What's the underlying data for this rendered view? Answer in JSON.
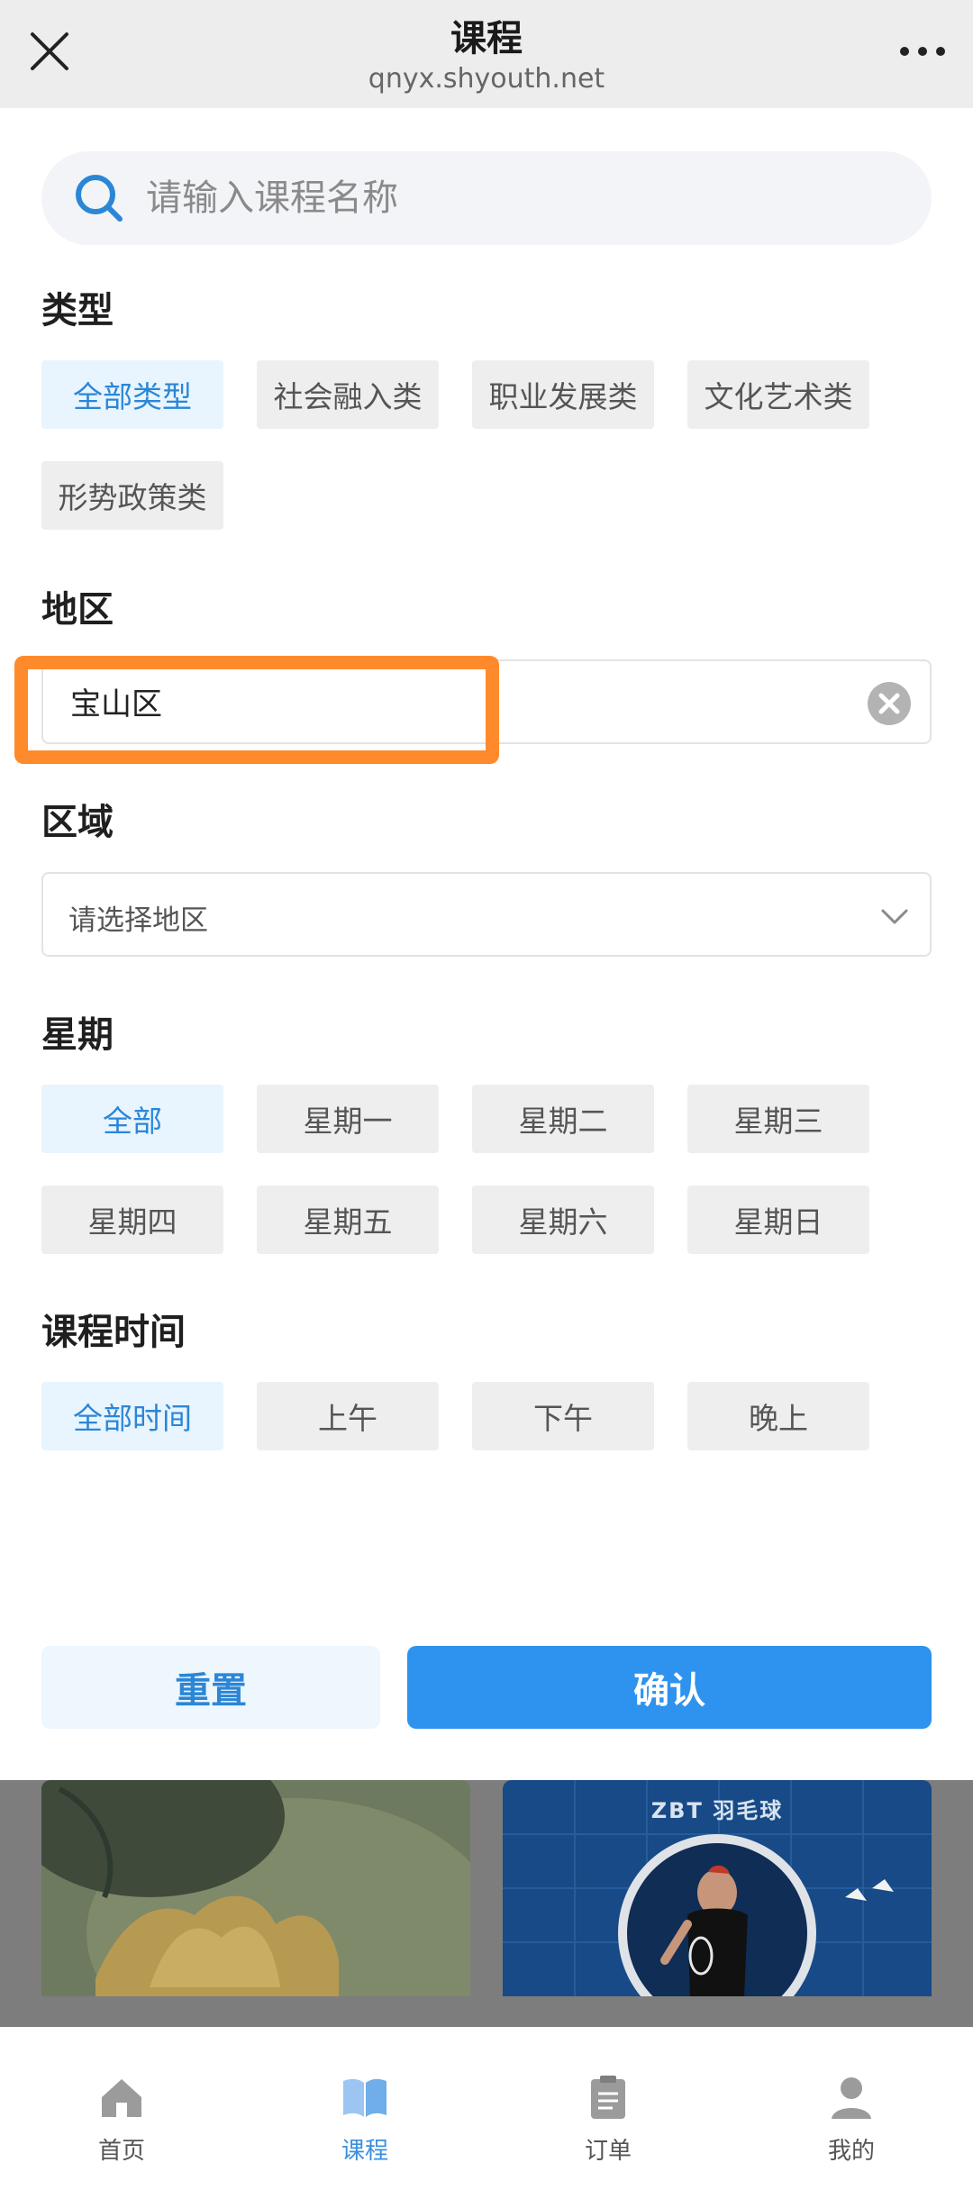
{
  "header": {
    "title": "课程",
    "subtitle": "qnyx.shyouth.net"
  },
  "search": {
    "placeholder": "请输入课程名称",
    "value": ""
  },
  "type_section": {
    "title": "类型",
    "options": [
      {
        "label": "全部类型",
        "active": true
      },
      {
        "label": "社会融入类",
        "active": false
      },
      {
        "label": "职业发展类",
        "active": false
      },
      {
        "label": "文化艺术类",
        "active": false
      },
      {
        "label": "形势政策类",
        "active": false
      }
    ]
  },
  "region_section": {
    "title": "地区",
    "value": "宝山区"
  },
  "area_section": {
    "title": "区域",
    "placeholder": "请选择地区"
  },
  "weekday_section": {
    "title": "星期",
    "options": [
      {
        "label": "全部",
        "active": true
      },
      {
        "label": "星期一",
        "active": false
      },
      {
        "label": "星期二",
        "active": false
      },
      {
        "label": "星期三",
        "active": false
      },
      {
        "label": "星期四",
        "active": false
      },
      {
        "label": "星期五",
        "active": false
      },
      {
        "label": "星期六",
        "active": false
      },
      {
        "label": "星期日",
        "active": false
      }
    ]
  },
  "time_section": {
    "title": "课程时间",
    "options": [
      {
        "label": "全部时间",
        "active": true
      },
      {
        "label": "上午",
        "active": false
      },
      {
        "label": "下午",
        "active": false
      },
      {
        "label": "晚上",
        "active": false
      }
    ]
  },
  "actions": {
    "reset_label": "重置",
    "confirm_label": "确认"
  },
  "background_cards": [
    {
      "title": ""
    },
    {
      "title": "ZBT 羽毛球"
    }
  ],
  "bottom_nav": [
    {
      "label": "首页",
      "icon": "home-icon",
      "active": false
    },
    {
      "label": "课程",
      "icon": "book-icon",
      "active": true
    },
    {
      "label": "订单",
      "icon": "clipboard-icon",
      "active": false
    },
    {
      "label": "我的",
      "icon": "user-icon",
      "active": false
    }
  ],
  "colors": {
    "accent": "#2e93ee",
    "highlight": "#ff8a2b",
    "active_chip_bg": "#e8f4fe"
  }
}
